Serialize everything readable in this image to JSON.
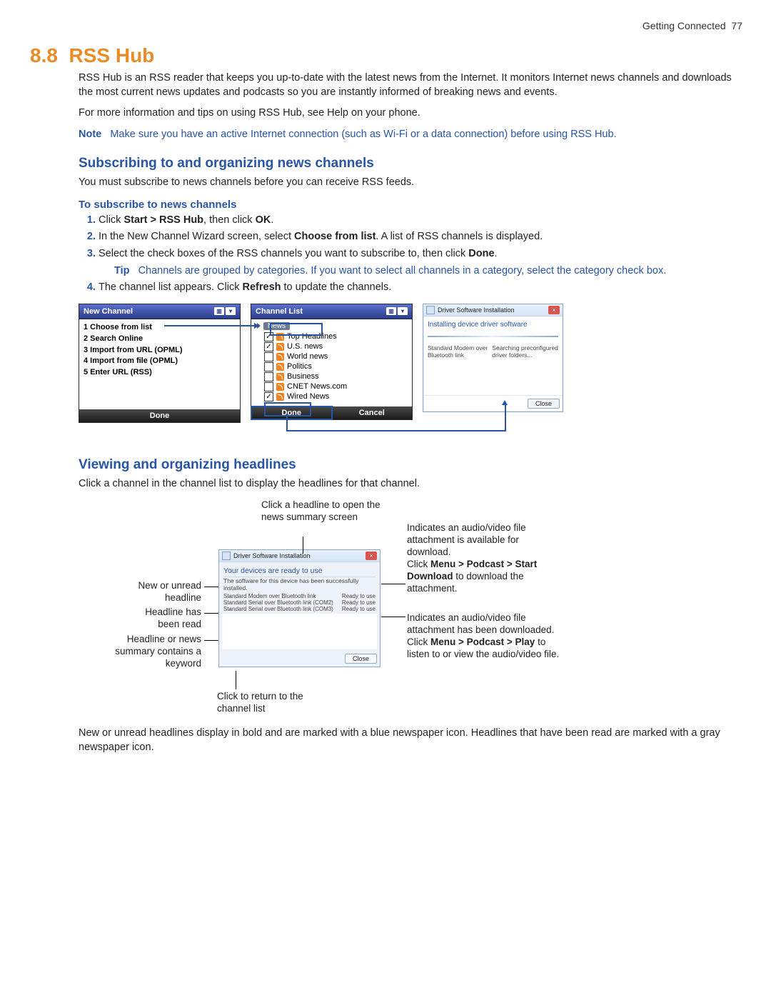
{
  "header": {
    "section": "Getting Connected",
    "page": "77"
  },
  "section": {
    "num": "8.8",
    "title": "RSS Hub"
  },
  "intro": {
    "p1": "RSS Hub is an RSS reader that keeps you up-to-date with the latest news from the Internet. It monitors Internet news channels and downloads the most current news updates and podcasts so you are instantly informed of breaking news and events.",
    "p2": "For more information and tips on using RSS Hub, see Help on your phone.",
    "note_label": "Note",
    "note_text": "Make sure you have an active Internet connection (such as Wi-Fi or a data connection) before using RSS Hub."
  },
  "sub1": {
    "h2": "Subscribing to and organizing news channels",
    "p": "You must subscribe to news channels before you can receive RSS feeds.",
    "h3": "To subscribe to news channels",
    "steps": {
      "s1_a": "Click ",
      "s1_b": "Start > RSS Hub",
      "s1_c": ", then click ",
      "s1_d": "OK",
      "s1_e": ".",
      "s2_a": "In the New Channel Wizard screen, select ",
      "s2_b": "Choose from list",
      "s2_c": ". A list of RSS channels is displayed.",
      "s3_a": "Select the check boxes of the RSS channels you want to subscribe to, then click ",
      "s3_b": "Done",
      "s3_c": ".",
      "tip_label": "Tip",
      "tip_text": "Channels are grouped by categories. If you want to select all channels in a category, select the category check box.",
      "s4_a": "The channel list appears. Click ",
      "s4_b": "Refresh",
      "s4_c": " to update the channels."
    }
  },
  "phone1": {
    "title": "New Channel",
    "items": [
      "1 Choose from list",
      "2 Search Online",
      "3 Import from URL (OPML)",
      "4 Import from file (OPML)",
      "5 Enter URL (RSS)"
    ],
    "done": "Done"
  },
  "phone2": {
    "title": "Channel List",
    "category": "News",
    "items": [
      {
        "checked": true,
        "label": "Top Headlines"
      },
      {
        "checked": true,
        "label": "U.S. news"
      },
      {
        "checked": false,
        "label": "World news"
      },
      {
        "checked": false,
        "label": "Politics"
      },
      {
        "checked": false,
        "label": "Business"
      },
      {
        "checked": false,
        "label": "CNET News.com"
      },
      {
        "checked": true,
        "label": "Wired News"
      }
    ],
    "done": "Done",
    "cancel": "Cancel"
  },
  "dialog1": {
    "title": "Driver Software Installation",
    "msg": "Installing device driver software",
    "left": "Standard Modem over Bluetooth link",
    "right": "Searching preconfigured driver folders...",
    "close": "Close"
  },
  "sub2": {
    "h2": "Viewing and organizing headlines",
    "p": "Click a channel in the channel list to display the headlines for that channel."
  },
  "fig2": {
    "a_top": "Click a headline to open the news summary screen",
    "a_left1": "New or unread headline",
    "a_left2": "Headline has been read",
    "a_left3": "Headline or news summary contains a keyword",
    "a_bottom": "Click to return to the channel list",
    "a_r1_a": "Indicates an audio/video file attachment is available for download.",
    "a_r1_b1": "Click ",
    "a_r1_b2": "Menu > Podcast > Start Download",
    "a_r1_b3": " to download the attachment.",
    "a_r2_a": "Indicates an audio/video file attachment has been downloaded.",
    "a_r2_b1": "Click ",
    "a_r2_b2": "Menu > Podcast > Play",
    "a_r2_b3": " to listen to or view the audio/video file."
  },
  "dialog2": {
    "title": "Driver Software Installation",
    "msg": "Your devices are ready to use",
    "sub": "The software for this device has been successfully installed.",
    "rows": [
      {
        "l": "Standard Modem over Bluetooth link",
        "r": "Ready to use"
      },
      {
        "l": "Standard Serial over Bluetooth link (COM2)",
        "r": "Ready to use"
      },
      {
        "l": "Standard Serial over Bluetooth link (COM3)",
        "r": "Ready to use"
      }
    ],
    "close": "Close"
  },
  "closing": "New or unread headlines display in bold and are marked with a blue newspaper icon. Headlines that have been read are marked with a gray newspaper icon."
}
